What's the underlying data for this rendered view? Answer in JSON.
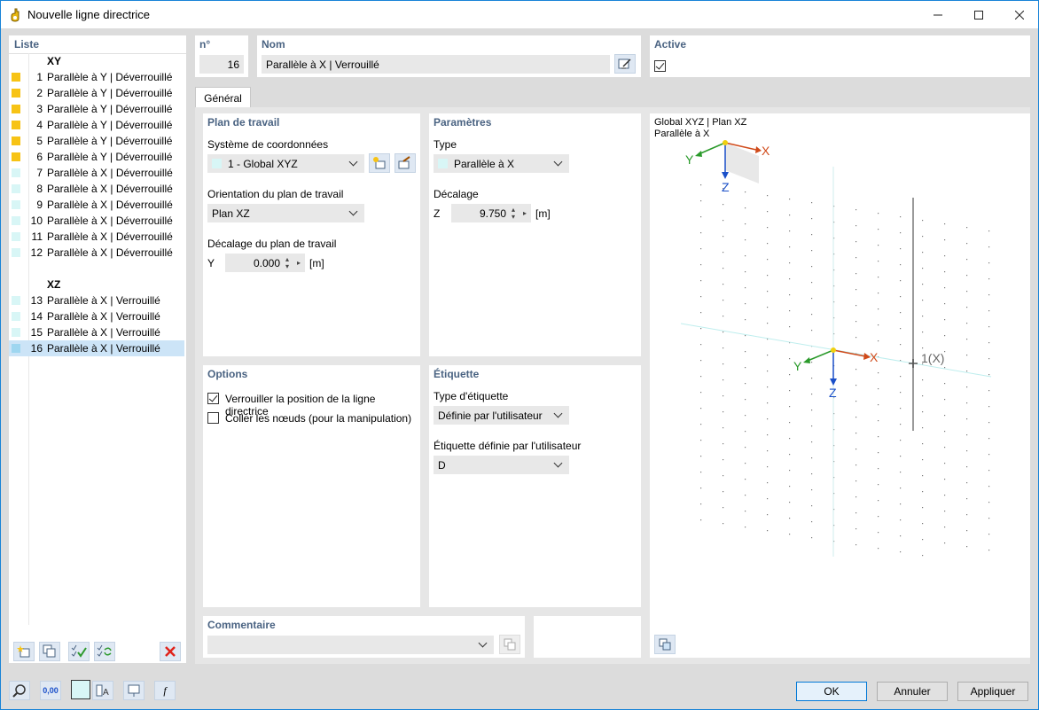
{
  "window": {
    "title": "Nouvelle ligne directrice"
  },
  "colors": {
    "yellow": "#f7c315",
    "cyan": "#d8f6f6",
    "selected": "#cce4f7",
    "section_title": "#4a6382"
  },
  "list": {
    "title": "Liste",
    "groups": [
      {
        "label": "XY",
        "items": [
          {
            "num": "1",
            "name": "Parallèle à Y | Déverrouillé",
            "color": "yellow"
          },
          {
            "num": "2",
            "name": "Parallèle à Y | Déverrouillé",
            "color": "yellow"
          },
          {
            "num": "3",
            "name": "Parallèle à Y | Déverrouillé",
            "color": "yellow"
          },
          {
            "num": "4",
            "name": "Parallèle à Y | Déverrouillé",
            "color": "yellow"
          },
          {
            "num": "5",
            "name": "Parallèle à Y | Déverrouillé",
            "color": "yellow"
          },
          {
            "num": "6",
            "name": "Parallèle à Y | Déverrouillé",
            "color": "yellow"
          },
          {
            "num": "7",
            "name": "Parallèle à X | Déverrouillé",
            "color": "cyan"
          },
          {
            "num": "8",
            "name": "Parallèle à X | Déverrouillé",
            "color": "cyan"
          },
          {
            "num": "9",
            "name": "Parallèle à X | Déverrouillé",
            "color": "cyan"
          },
          {
            "num": "10",
            "name": "Parallèle à X | Déverrouillé",
            "color": "cyan"
          },
          {
            "num": "11",
            "name": "Parallèle à X | Déverrouillé",
            "color": "cyan"
          },
          {
            "num": "12",
            "name": "Parallèle à X | Déverrouillé",
            "color": "cyan"
          }
        ]
      },
      {
        "label": "XZ",
        "items": [
          {
            "num": "13",
            "name": "Parallèle à X | Verrouillé",
            "color": "cyan"
          },
          {
            "num": "14",
            "name": "Parallèle à X | Verrouillé",
            "color": "cyan"
          },
          {
            "num": "15",
            "name": "Parallèle à X | Verrouillé",
            "color": "cyan"
          },
          {
            "num": "16",
            "name": "Parallèle à X | Verrouillé",
            "color": "cyan",
            "selected": true
          }
        ]
      }
    ]
  },
  "header": {
    "num_label": "n°",
    "num_value": "16",
    "name_label": "Nom",
    "name_value": "Parallèle à X | Verrouillé",
    "active_label": "Active",
    "active_checked": true
  },
  "tabs": [
    {
      "label": "Général",
      "active": true
    }
  ],
  "workplane": {
    "title": "Plan de travail",
    "coord_label": "Système de coordonnées",
    "coord_value": "1 - Global XYZ",
    "orient_label": "Orientation du plan de travail",
    "orient_value": "Plan XZ",
    "offset_label": "Décalage du plan de travail",
    "offset_axis": "Y",
    "offset_value": "0.000",
    "offset_unit": "[m]"
  },
  "params": {
    "title": "Paramètres",
    "type_label": "Type",
    "type_value": "Parallèle à X",
    "offset_label": "Décalage",
    "offset_axis": "Z",
    "offset_value": "9.750",
    "offset_unit": "[m]"
  },
  "options": {
    "title": "Options",
    "lock_label": "Verrouiller la position de la ligne directrice",
    "lock_checked": true,
    "snap_label": "Coller les nœuds (pour la manipulation)",
    "snap_checked": false
  },
  "etiquette": {
    "title": "Étiquette",
    "type_label": "Type d'étiquette",
    "type_value": "Définie par l'utilisateur",
    "user_label": "Étiquette définie par l'utilisateur",
    "user_value": "D"
  },
  "comment": {
    "title": "Commentaire",
    "value": ""
  },
  "preview": {
    "line1": "Global XYZ | Plan XZ",
    "line2": "Parallèle à X",
    "axis_x": "X",
    "axis_y": "Y",
    "axis_z": "Z",
    "line_label": "1(X)"
  },
  "bottom_icons": {
    "decimal_label": "0,00"
  },
  "buttons": {
    "ok": "OK",
    "cancel": "Annuler",
    "apply": "Appliquer"
  }
}
